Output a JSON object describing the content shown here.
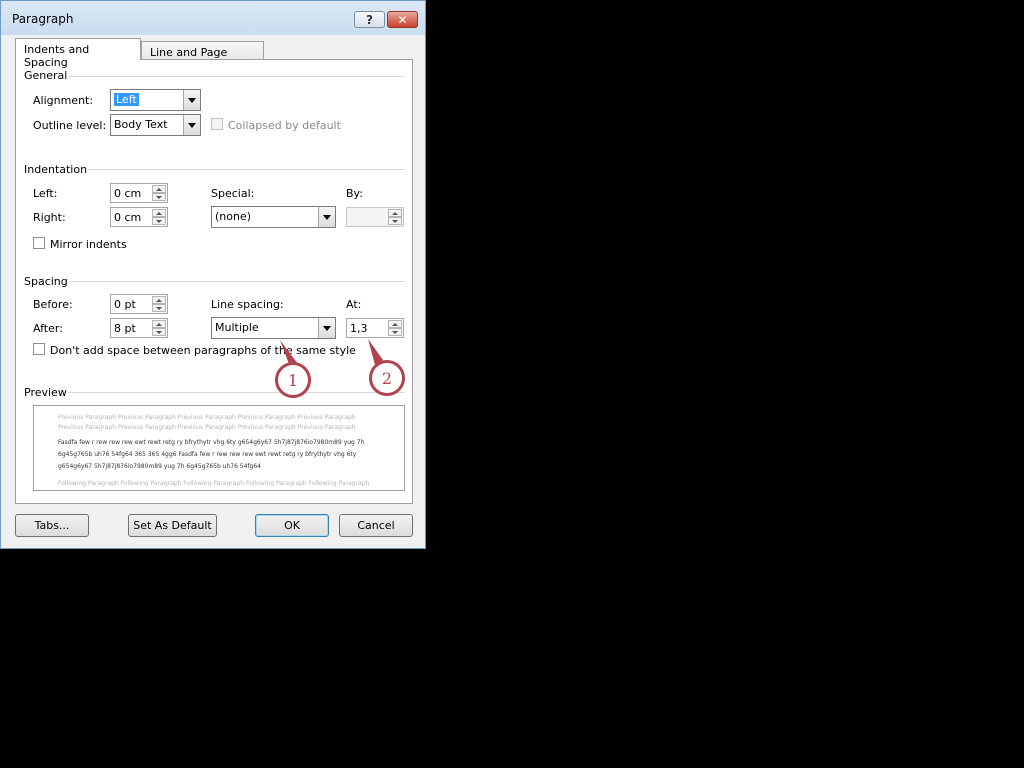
{
  "window": {
    "title": "Paragraph",
    "help": "?",
    "close": "✕"
  },
  "tabs": [
    {
      "label": "Indents and Spacing",
      "active": true
    },
    {
      "label": "Line and Page Breaks",
      "active": false
    }
  ],
  "general": {
    "heading": "General",
    "alignment_label": "Alignment:",
    "alignment_value": "Left",
    "outline_label": "Outline level:",
    "outline_value": "Body Text",
    "collapsed_label": "Collapsed by default"
  },
  "indentation": {
    "heading": "Indentation",
    "left_label": "Left:",
    "left_value": "0 cm",
    "right_label": "Right:",
    "right_value": "0 cm",
    "special_label": "Special:",
    "special_value": "(none)",
    "by_label": "By:",
    "by_value": "",
    "mirror_label": "Mirror indents"
  },
  "spacing": {
    "heading": "Spacing",
    "before_label": "Before:",
    "before_value": "0 pt",
    "after_label": "After:",
    "after_value": "8 pt",
    "line_spacing_label": "Line spacing:",
    "line_spacing_value": "Multiple",
    "at_label": "At:",
    "at_value": "1,3",
    "dont_add_label": "Don't add space between paragraphs of the same style"
  },
  "preview": {
    "heading": "Preview",
    "previous_1": "Previous Paragraph Previous Paragraph Previous Paragraph Previous Paragraph Previous Paragraph",
    "previous_2": "Previous Paragraph Previous Paragraph Previous Paragraph Previous Paragraph Previous Paragraph",
    "sample_1": "Fasdfa few r rew rew rew  ewt rewt retg ry bfrythytr vhg 6ty g654g6y67 5h7j87j876io7980m89  yug 7h",
    "sample_2": "6g45g765b uh76 54fg64 365 365 4gg6 Fasdfa few r rew rew rew  ewt rewt retg ry bfrythytr vhg 6ty",
    "sample_3": "g654g6y67 5h7j87j876io7980m89  yug 7h 6g45g765b uh76 54fg64",
    "following": "Following Paragraph Following Paragraph Following Paragraph Following Paragraph Following Paragraph"
  },
  "buttons": {
    "tabs": "Tabs...",
    "set_default": "Set As Default",
    "ok": "OK",
    "cancel": "Cancel"
  },
  "callouts": [
    "1",
    "2"
  ],
  "colors": {
    "callout": "#b0434e",
    "selection": "#3399ff",
    "titlebar": "#dce9f6"
  }
}
